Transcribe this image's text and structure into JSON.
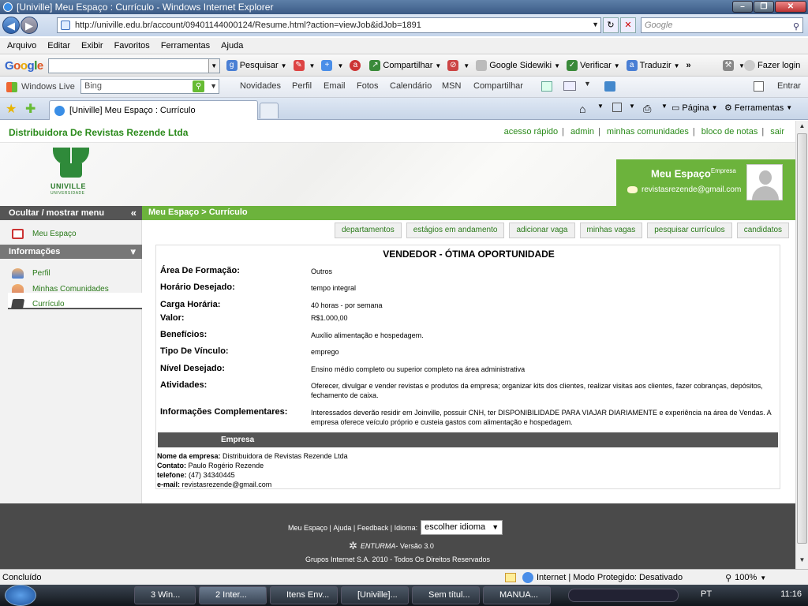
{
  "window": {
    "title": "[Univille] Meu Espaço : Currículo - Windows Internet Explorer"
  },
  "address": {
    "url": "http://univille.edu.br/account/09401144000124/Resume.html?action=viewJob&idJob=1891",
    "search_placeholder": "Google"
  },
  "menu": [
    "Arquivo",
    "Editar",
    "Exibir",
    "Favoritos",
    "Ferramentas",
    "Ajuda"
  ],
  "google_toolbar": {
    "pesquisar": "Pesquisar",
    "compartilhar": "Compartilhar",
    "sidewiki": "Google Sidewiki",
    "verificar": "Verificar",
    "traduzir": "Traduzir",
    "login": "Fazer login"
  },
  "live_toolbar": {
    "brand": "Windows Live",
    "search_value": "Bing",
    "links": [
      "Novidades",
      "Perfil",
      "Email",
      "Fotos",
      "Calendário",
      "MSN",
      "Compartilhar"
    ],
    "entrar": "Entrar"
  },
  "tabbar": {
    "tab_title": "[Univille] Meu Espaço : Currículo",
    "pagina": "Página",
    "ferramentas": "Ferramentas"
  },
  "page": {
    "company": "Distribuidora De Revistas Rezende Ltda",
    "quicklinks": [
      "acesso rápido",
      "admin",
      "minhas comunidades",
      "bloco de notas",
      "sair"
    ],
    "logo_text": "UNIVILLE",
    "logo_sub": "UNIVERSIDADE",
    "my_space": {
      "title": "Meu Espaço",
      "sup": "Empresa",
      "email": "revistasrezende@gmail.com"
    },
    "sidebar": {
      "toggle_label": "Ocultar / mostrar menu",
      "meu_espaco": "Meu Espaço",
      "info_title": "Informações",
      "items": [
        "Perfil",
        "Minhas Comunidades",
        "Currículo"
      ]
    },
    "breadcrumb": "Meu Espaço >  Currículo",
    "tabs": [
      "departamentos",
      "estágios em andamento",
      "adicionar vaga",
      "minhas vagas",
      "pesquisar currículos",
      "candidatos"
    ],
    "job": {
      "title": "VENDEDOR - ÓTIMA OPORTUNIDADE",
      "fields": [
        {
          "label": "Área De Formação:",
          "value": "Outros"
        },
        {
          "label": "Horário Desejado:",
          "value": "tempo integral"
        },
        {
          "label": "Carga Horária:",
          "value": "40 horas - por semana"
        },
        {
          "label": "Valor:",
          "value": "R$1.000,00"
        },
        {
          "label": "Benefícios:",
          "value": "Auxílio alimentação e hospedagem."
        },
        {
          "label": "Tipo De Vínculo:",
          "value": "emprego"
        },
        {
          "label": "Nível Desejado:",
          "value": "Ensino médio completo ou superior completo na área administrativa"
        },
        {
          "label": "Atividades:",
          "value": "Oferecer, divulgar e vender revistas e produtos da empresa; organizar kits dos clientes, realizar visitas aos clientes, fazer cobranças, depósitos, fechamento de caixa."
        },
        {
          "label": "Informações Complementares:",
          "value": "Interessados deverão residir em Joinville, possuir CNH, ter DISPONIBILIDADE PARA VIAJAR DIARIAMENTE e experiência na área de Vendas. A empresa oferece veículo próprio e custeia gastos com alimentação e hospedagem."
        }
      ]
    },
    "empresa": {
      "title": "Empresa",
      "nome_label": "Nome da empresa:",
      "nome": "Distribuidora de Revistas Rezende Ltda",
      "contato_label": "Contato:",
      "contato": "Paulo Rogério Rezende",
      "telefone_label": "telefone:",
      "telefone": "(47) 34340445",
      "email_label": "e-mail:",
      "email": "revistasrezende@gmail.com"
    },
    "footer": {
      "links": [
        "Meu Espaço",
        "Ajuda",
        "Feedback",
        "Idioma:"
      ],
      "language": "escolher idioma",
      "enturma": "ENTURMA",
      "versao": " - Versão 3.0",
      "copyright": "Grupos Internet S.A. 2010 - Todos Os Direitos Reservados"
    }
  },
  "status": {
    "text": "Concluído",
    "zone": "Internet | Modo Protegido: Desativado",
    "zoom": "100%"
  },
  "taskbar": {
    "tasks": [
      "3 Win...",
      "2 Inter...",
      "Itens Env...",
      "[Univille]...",
      "Sem títul...",
      "MANUA..."
    ],
    "lang": "PT",
    "clock": "11:16"
  }
}
